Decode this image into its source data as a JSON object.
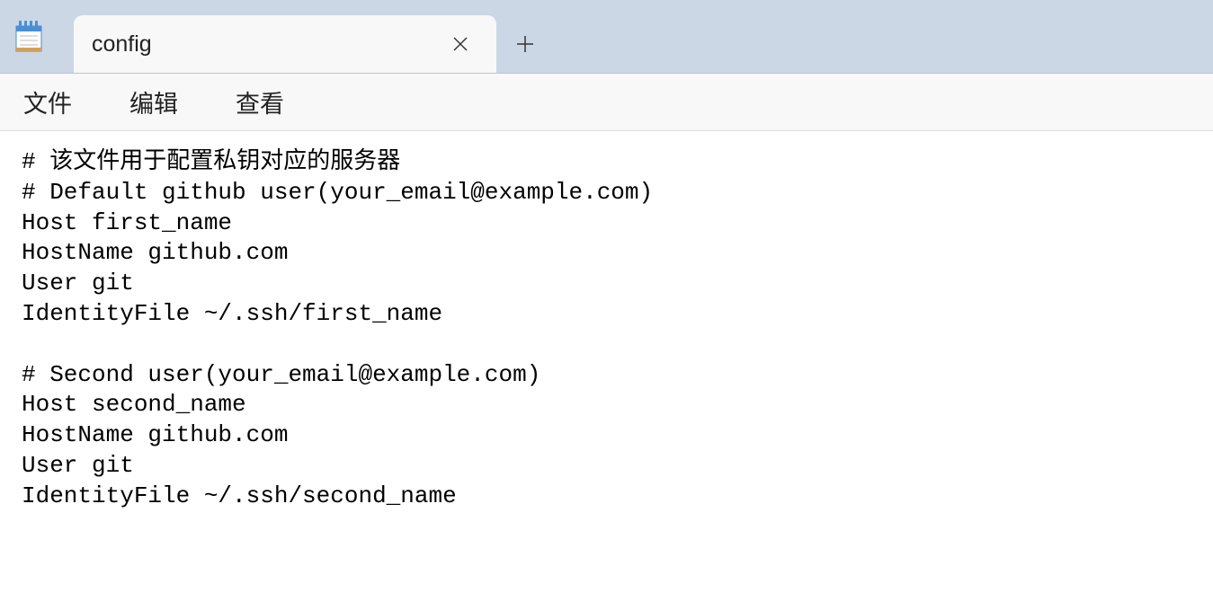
{
  "tab": {
    "title": "config"
  },
  "menu": {
    "file": "文件",
    "edit": "编辑",
    "view": "查看"
  },
  "editor": {
    "content": "# 该文件用于配置私钥对应的服务器\n# Default github user(your_email@example.com)\nHost first_name\nHostName github.com\nUser git\nIdentityFile ~/.ssh/first_name\n\n# Second user(your_email@example.com)\nHost second_name\nHostName github.com\nUser git\nIdentityFile ~/.ssh/second_name"
  }
}
